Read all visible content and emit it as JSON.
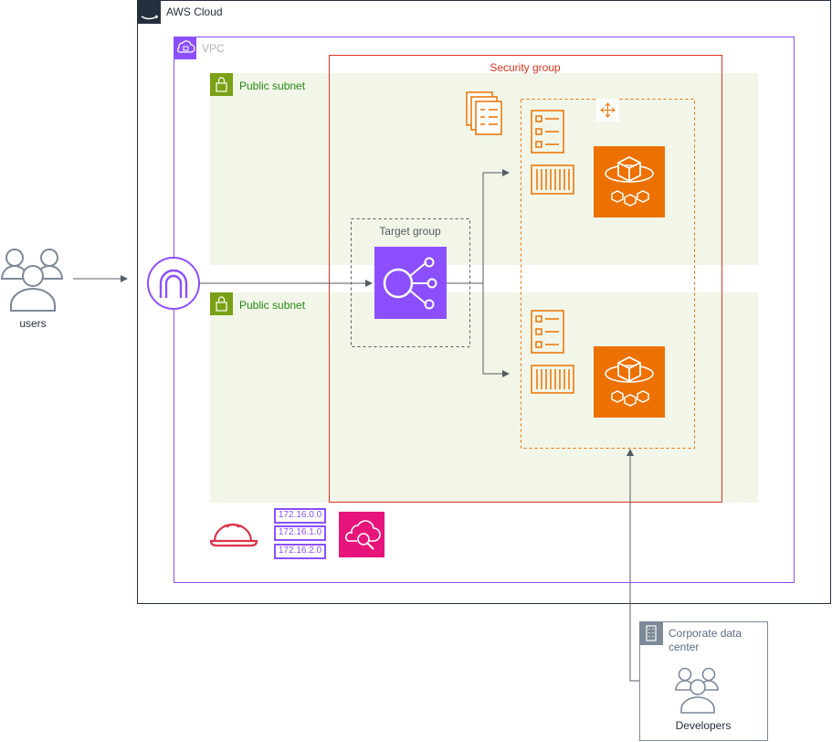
{
  "users_label": "users",
  "cloud": {
    "label": "AWS Cloud",
    "badge": "aws"
  },
  "vpc": {
    "label": "VPC"
  },
  "security_group": {
    "label": "Security group"
  },
  "subnets": [
    {
      "label": "Public subnet"
    },
    {
      "label": "Public subnet"
    }
  ],
  "target_group": {
    "label": "Target group"
  },
  "cidr_blocks": [
    "172.16.0.0",
    "172.16.1.0",
    "172.16.2.0"
  ],
  "datacenter": {
    "label_line1": "Corporate data",
    "label_line2": "center",
    "developers_label": "Developers"
  },
  "colors": {
    "cloud_border": "#242f3e",
    "vpc": "#8c4fff",
    "security_group": "#dd3522",
    "subnet_fill": "#f2f6e8",
    "subnet_icon": "#7aa116",
    "subnet_text": "#248814",
    "compute_orange": "#ed7100",
    "elb_purple": "#8c4fff",
    "pink": "#e7157b",
    "red_helmet": "#dd344c",
    "gray": "#7d8998",
    "arrow": "#545b64",
    "target_group_text": "#545b64"
  },
  "icons": [
    "users-icon",
    "internet-gateway-icon",
    "load-balancer-icon",
    "ecs-service-icon",
    "task-definition-icon",
    "container-icon",
    "auto-scaling-icon",
    "helmet-icon",
    "cidr-block-icon",
    "cloud-search-icon",
    "building-icon",
    "padlock-icon"
  ]
}
